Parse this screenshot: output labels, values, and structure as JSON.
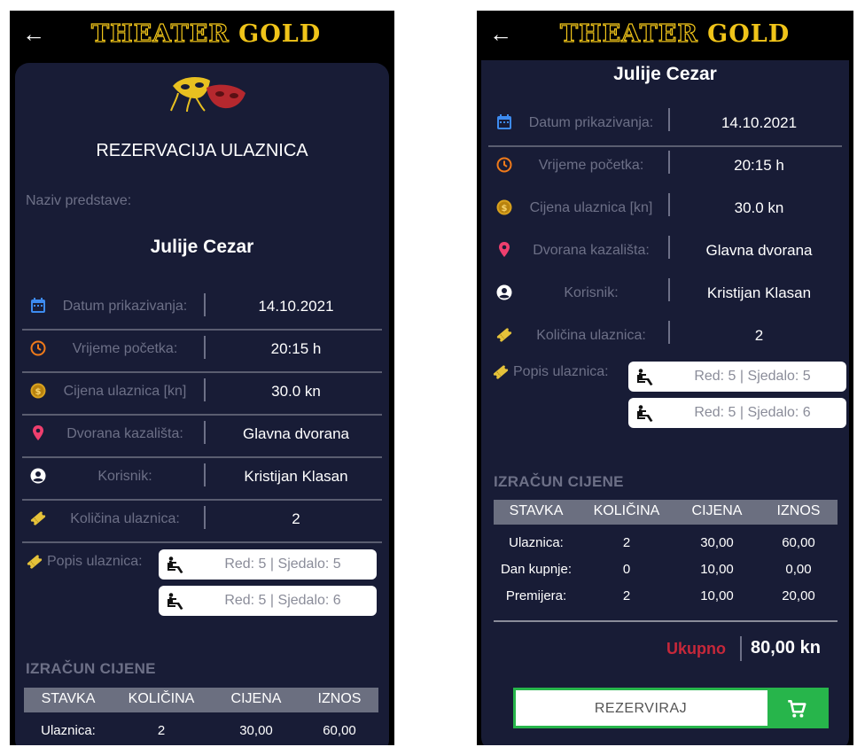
{
  "app": {
    "brand_part1": "THEATER",
    "brand_part2": "GOLD"
  },
  "colors": {
    "card_bg": "#181c36",
    "gold": "#f0c419",
    "accent_green": "#27b54b",
    "total_red": "#c6283a"
  },
  "reservation": {
    "heading": "REZERVACIJA ULAZNICA",
    "show_label": "Naziv predstave:",
    "show_title": "Julije Cezar",
    "rows": [
      {
        "icon": "calendar-icon",
        "label": "Datum prikazivanja:",
        "value": "14.10.2021"
      },
      {
        "icon": "clock-icon",
        "label": "Vrijeme početka:",
        "value": "20:15 h"
      },
      {
        "icon": "coin-icon",
        "label": "Cijena ulaznica [kn]",
        "value": "30.0 kn"
      },
      {
        "icon": "location-pin-icon",
        "label": "Dvorana kazališta:",
        "value": "Glavna dvorana"
      },
      {
        "icon": "user-icon",
        "label": "Korisnik:",
        "value": "Kristijan Klasan"
      },
      {
        "icon": "ticket-icon",
        "label": "Količina ulaznica:",
        "value": "2"
      }
    ],
    "tickets_label": "Popis ulaznica:",
    "tickets": [
      {
        "row_label": "Red: 5 |",
        "seat_label": "Sjedalo: 5"
      },
      {
        "row_label": "Red: 5 |",
        "seat_label": "Sjedalo: 6"
      }
    ]
  },
  "pricing": {
    "title": "IZRAČUN CIJENE",
    "columns": [
      "STAVKA",
      "KOLIČINA",
      "CIJENA",
      "IZNOS"
    ],
    "rows": [
      [
        "Ulaznica:",
        "2",
        "30,00",
        "60,00"
      ],
      [
        "Dan kupnje:",
        "0",
        "10,00",
        "0,00"
      ],
      [
        "Premijera:",
        "2",
        "10,00",
        "20,00"
      ]
    ],
    "total_label": "Ukupno",
    "total_value": "80,00 kn",
    "reserve_label": "REZERVIRAJ"
  }
}
